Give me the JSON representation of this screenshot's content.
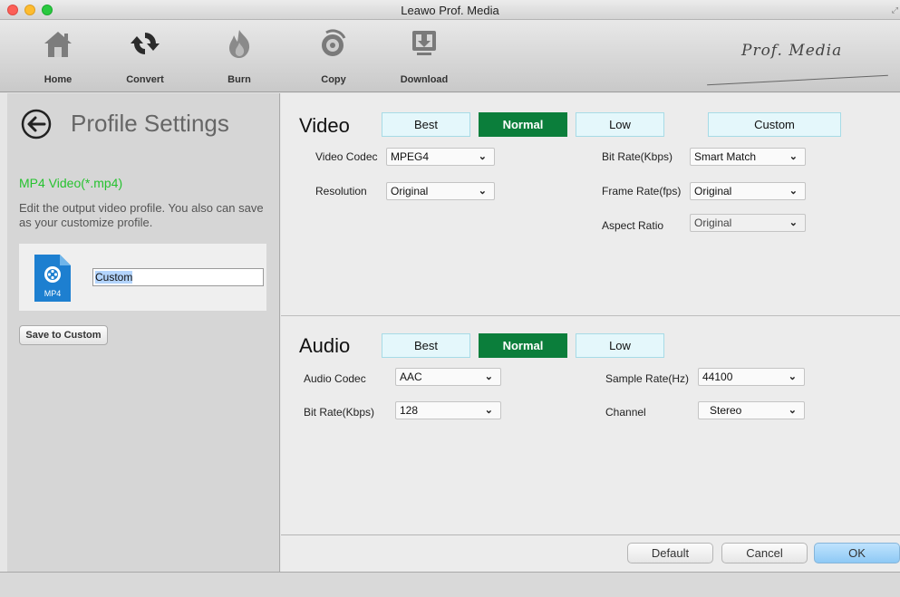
{
  "window": {
    "title": "Leawo Prof. Media"
  },
  "toolbar": {
    "home": "Home",
    "convert": "Convert",
    "burn": "Burn",
    "copy": "Copy",
    "download": "Download",
    "brand": "Prof. Media"
  },
  "profile": {
    "title": "Profile Settings",
    "format": "MP4 Video(*.mp4)",
    "description": "Edit the output video profile. You also can save as your customize profile.",
    "icon_label": "MP4",
    "custom_name": "Custom",
    "save_button": "Save to Custom"
  },
  "video": {
    "title": "Video",
    "presets": [
      "Best",
      "Normal",
      "Low",
      "Custom"
    ],
    "active_preset": "Normal",
    "fields": {
      "codec_label": "Video Codec",
      "codec_value": "MPEG4",
      "resolution_label": "Resolution",
      "resolution_value": "Original",
      "bitrate_label": "Bit Rate(Kbps)",
      "bitrate_value": "Smart Match",
      "framerate_label": "Frame Rate(fps)",
      "framerate_value": "Original",
      "aspect_label": "Aspect Ratio",
      "aspect_value": "Original"
    }
  },
  "audio": {
    "title": "Audio",
    "presets": [
      "Best",
      "Normal",
      "Low"
    ],
    "active_preset": "Normal",
    "fields": {
      "codec_label": "Audio Codec",
      "codec_value": "AAC",
      "bitrate_label": "Bit Rate(Kbps)",
      "bitrate_value": "128",
      "samplerate_label": "Sample Rate(Hz)",
      "samplerate_value": "44100",
      "channel_label": "Channel",
      "channel_value": "Stereo"
    }
  },
  "footer": {
    "default": "Default",
    "cancel": "Cancel",
    "ok": "OK"
  },
  "icons": {
    "dropdown": "chevron-down-icon",
    "back": "back-arrow-icon"
  }
}
